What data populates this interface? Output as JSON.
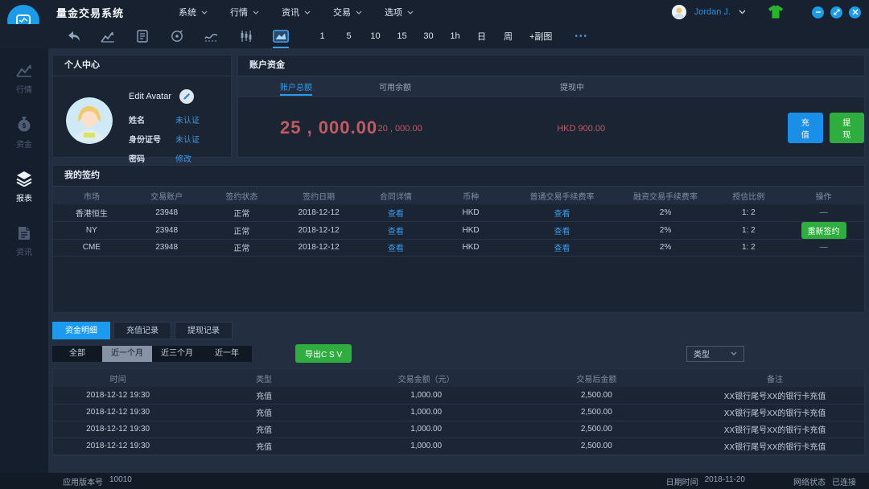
{
  "topbar": {
    "title": "量金交易系统",
    "menus": [
      {
        "label": "系统"
      },
      {
        "label": "行情"
      },
      {
        "label": "资讯"
      },
      {
        "label": "交易"
      },
      {
        "label": "选项"
      }
    ],
    "user_name": "Jordan J.",
    "window_controls": [
      "minimize",
      "restore",
      "close"
    ]
  },
  "toolbar": {
    "icon_names": [
      "back-icon",
      "chart-up-icon",
      "order-list-icon",
      "target-icon",
      "trend-line-icon",
      "candlestick-icon",
      "chart-image-icon"
    ],
    "active_icon": "chart-image-icon",
    "periods": [
      "1",
      "5",
      "10",
      "15",
      "30",
      "1h",
      "日",
      "周"
    ],
    "add_subchart": "+副图",
    "more": "•••"
  },
  "sidebar": {
    "items": [
      {
        "label": "行情",
        "icon": "market-chart-icon",
        "active": false
      },
      {
        "label": "资金",
        "icon": "money-bag-icon",
        "active": false
      },
      {
        "label": "报表",
        "icon": "report-layers-icon",
        "active": true
      },
      {
        "label": "资讯",
        "icon": "news-doc-icon",
        "active": false
      }
    ]
  },
  "personal": {
    "title": "个人中心",
    "edit_avatar_label": "Edit Avatar",
    "fields": [
      {
        "label": "姓名",
        "value": "未认证"
      },
      {
        "label": "身份证号",
        "value": "未认证"
      },
      {
        "label": "密码",
        "value": "修改"
      }
    ]
  },
  "funds": {
    "title": "账户资金",
    "columns": [
      {
        "label": "账户总额",
        "value": "25 , 000.00"
      },
      {
        "label": "可用余额",
        "value": "20 , 000.00"
      },
      {
        "label": "提现中",
        "value": "HKD 900.00"
      }
    ],
    "recharge_label": "充值",
    "withdraw_label": "提现"
  },
  "contracts": {
    "title": "我的签约",
    "headers": [
      "市场",
      "交易账户",
      "签约状态",
      "签约日期",
      "合同详情",
      "币种",
      "普通交易手续费率",
      "融资交易手续费率",
      "授信比例",
      "操作"
    ],
    "rows": [
      {
        "market": "香港恒生",
        "account": "23948",
        "status": "正常",
        "date": "2018-12-12",
        "contract": "查看",
        "currency": "HKD",
        "normal_fee": "查看",
        "finance_fee": "2%",
        "credit_ratio": "1: 2",
        "action": "—"
      },
      {
        "market": "NY",
        "account": "23948",
        "status": "正常",
        "date": "2018-12-12",
        "contract": "查看",
        "currency": "HKD",
        "normal_fee": "查看",
        "finance_fee": "2%",
        "credit_ratio": "1: 2",
        "action": "重新签约"
      },
      {
        "market": "CME",
        "account": "23948",
        "status": "正常",
        "date": "2018-12-12",
        "contract": "查看",
        "currency": "HKD",
        "normal_fee": "查看",
        "finance_fee": "2%",
        "credit_ratio": "1: 2",
        "action": "—"
      }
    ]
  },
  "records": {
    "tabs": [
      {
        "label": "资金明细",
        "active": true
      },
      {
        "label": "充值记录",
        "active": false
      },
      {
        "label": "提现记录",
        "active": false
      }
    ],
    "filters": [
      {
        "label": "全部",
        "active": false
      },
      {
        "label": "近一个月",
        "active": true
      },
      {
        "label": "近三个月",
        "active": false
      },
      {
        "label": "近一年",
        "active": false
      }
    ],
    "export_label": "导出C S V",
    "type_select_label": "类型",
    "headers": [
      "时间",
      "类型",
      "交易金额（元）",
      "交易后金额",
      "备注"
    ],
    "rows": [
      {
        "time": "2018-12-12 19:30",
        "type": "充值",
        "amount": "1,000.00",
        "balance": "2,500.00",
        "note": "XX银行尾号XX的银行卡充值"
      },
      {
        "time": "2018-12-12 19:30",
        "type": "充值",
        "amount": "1,000.00",
        "balance": "2,500.00",
        "note": "XX银行尾号XX的银行卡充值"
      },
      {
        "time": "2018-12-12 19:30",
        "type": "充值",
        "amount": "1,000.00",
        "balance": "2,500.00",
        "note": "XX银行尾号XX的银行卡充值"
      },
      {
        "time": "2018-12-12 19:30",
        "type": "充值",
        "amount": "1,000.00",
        "balance": "2,500.00",
        "note": "XX银行尾号XX的银行卡充值"
      }
    ]
  },
  "statusbar": {
    "version_label": "应用版本号",
    "version": "10010",
    "datetime_label": "日期时间",
    "datetime": "2018-11-20",
    "network_label": "网络状态",
    "network": "已连接"
  }
}
